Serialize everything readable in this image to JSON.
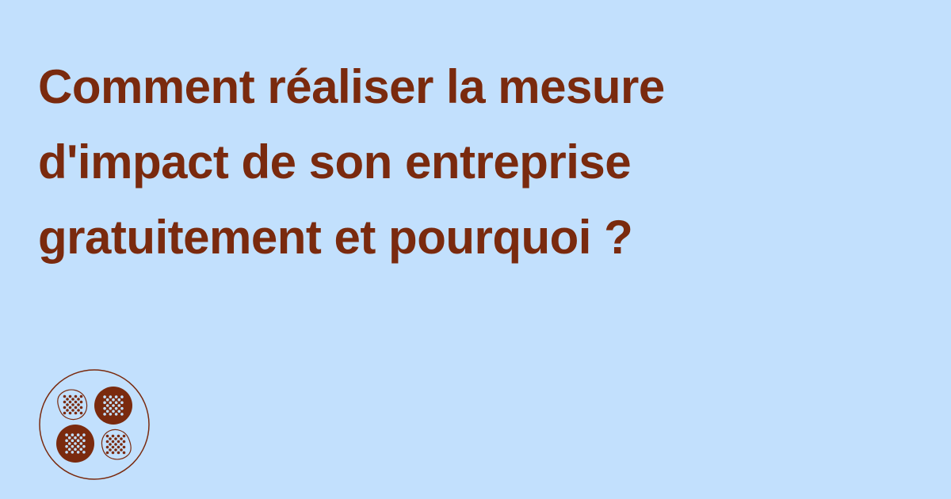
{
  "title_lines": [
    "Comment réaliser la mesure",
    "d'impact de son entreprise",
    "gratuitement et pourquoi ?"
  ],
  "colors": {
    "background": "#c2e0fd",
    "accent": "#7a2a0e"
  },
  "logo": {
    "icon": "brand-logo-dotted-circles-icon"
  }
}
